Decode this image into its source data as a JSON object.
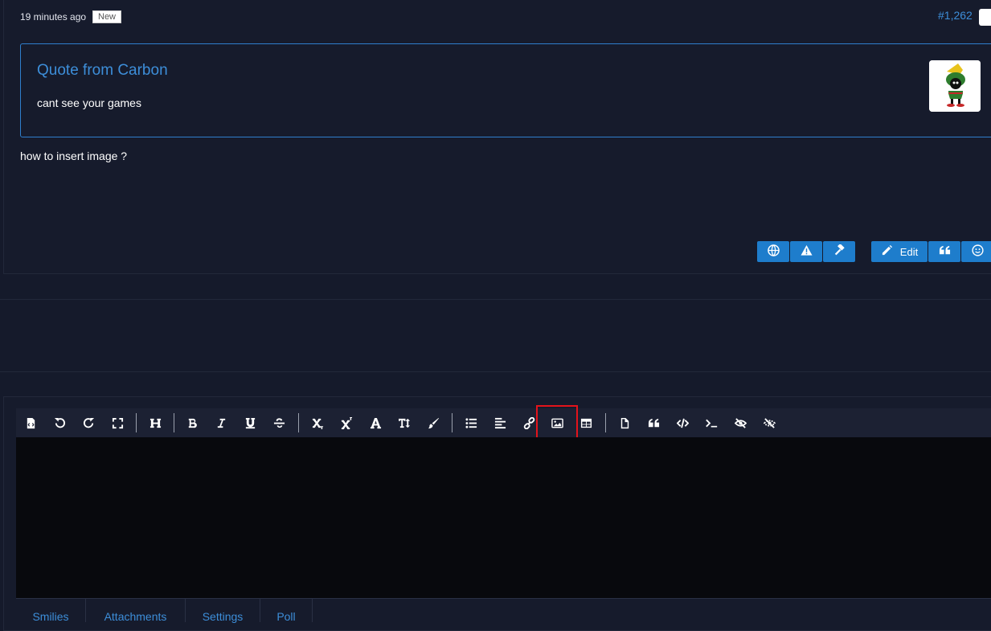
{
  "post": {
    "time": "19 minutes ago",
    "badge": "New",
    "number": "#1,262",
    "quote_title": "Quote from Carbon",
    "quote_text": "cant see your games",
    "body": "how to insert image ?",
    "edit_label": "Edit"
  },
  "editor": {
    "toolbar_icons": [
      "source-icon",
      "undo-icon",
      "redo-icon",
      "fullscreen-icon",
      "heading-icon",
      "bold-icon",
      "italic-icon",
      "underline-icon",
      "strikethrough-icon",
      "subscript-icon",
      "superscript-icon",
      "font-icon",
      "font-size-icon",
      "color-brush-icon",
      "list-icon",
      "align-left-icon",
      "link-icon",
      "image-icon",
      "table-icon",
      "file-icon",
      "quote-icon",
      "code-icon",
      "terminal-icon",
      "spoiler-icon",
      "hide-icon"
    ],
    "highlighted_icon": "image-icon",
    "tabs": [
      "Smilies",
      "Attachments",
      "Settings",
      "Poll"
    ]
  },
  "colors": {
    "accent": "#1e7dcc",
    "link": "#3d8ed9",
    "highlight": "#e4131b",
    "background": "#151a2b",
    "editor_bg": "#08090d"
  }
}
